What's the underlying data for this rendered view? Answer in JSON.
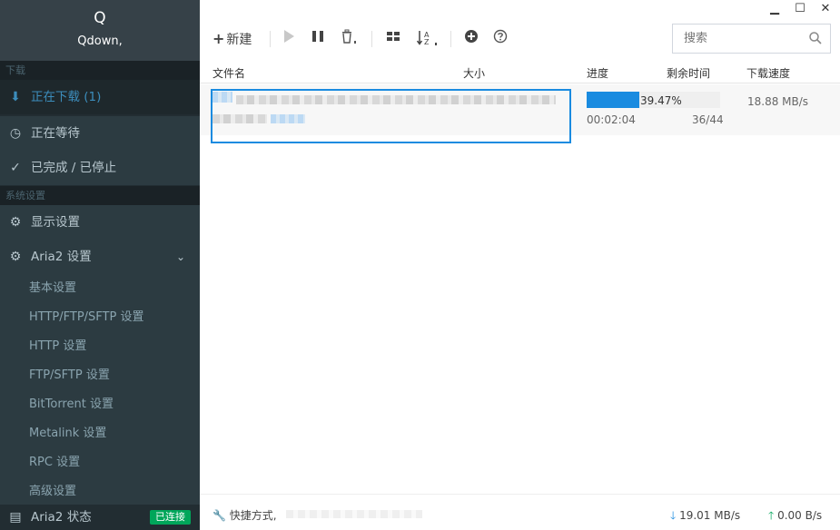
{
  "app": {
    "logo_letter": "Q",
    "name": "Qdown,"
  },
  "window_controls": {
    "minimize": "▁",
    "maximize": "☐",
    "close": "✕"
  },
  "sidebar": {
    "section_download": "下载",
    "items": [
      {
        "label": "正在下载 (1)",
        "icon": "download-circle-icon",
        "glyph": "⬇",
        "active": true
      },
      {
        "label": "正在等待",
        "icon": "clock-icon",
        "glyph": "◷",
        "active": false
      },
      {
        "label": "已完成 / 已停止",
        "icon": "check-circle-icon",
        "glyph": "✓",
        "active": false
      }
    ],
    "section_settings": "系统设置",
    "display_settings": {
      "label": "显示设置",
      "icon": "gear-icon",
      "glyph": "⚙"
    },
    "aria2_settings": {
      "label": "Aria2 设置",
      "icon": "gears-icon",
      "glyph": "⚙",
      "chevron": "⌄"
    },
    "sub_items": [
      "基本设置",
      "HTTP/FTP/SFTP 设置",
      "HTTP 设置",
      "FTP/SFTP 设置",
      "BitTorrent 设置",
      "Metalink 设置",
      "RPC 设置",
      "高级设置"
    ],
    "aria2_status": {
      "label": "Aria2 状态",
      "icon": "server-icon",
      "glyph": "▤",
      "badge": "已连接"
    }
  },
  "toolbar": {
    "new_label": "新建",
    "new_icon": "+",
    "sort_label": "A Z",
    "search_placeholder": "搜索"
  },
  "table": {
    "columns": {
      "name": "文件名",
      "size": "大小",
      "progress": "进度",
      "remaining": "剩余时间",
      "speed": "下载速度"
    },
    "task": {
      "progress_text": "39.47%",
      "progress_fraction": 0.3947,
      "elapsed": "00:02:04",
      "connections": "36/44",
      "speed": "18.88 MB/s"
    }
  },
  "statusbar": {
    "shortcut_label": "快捷方式,",
    "download_speed": "19.01 MB/s",
    "upload_speed": "0.00 B/s"
  },
  "colors": {
    "accent": "#1a8be0",
    "sidebar_bg": "#222d32",
    "badge_green": "#00a65a",
    "upload_green": "#00a65a",
    "download_blue": "#1a8be0"
  }
}
